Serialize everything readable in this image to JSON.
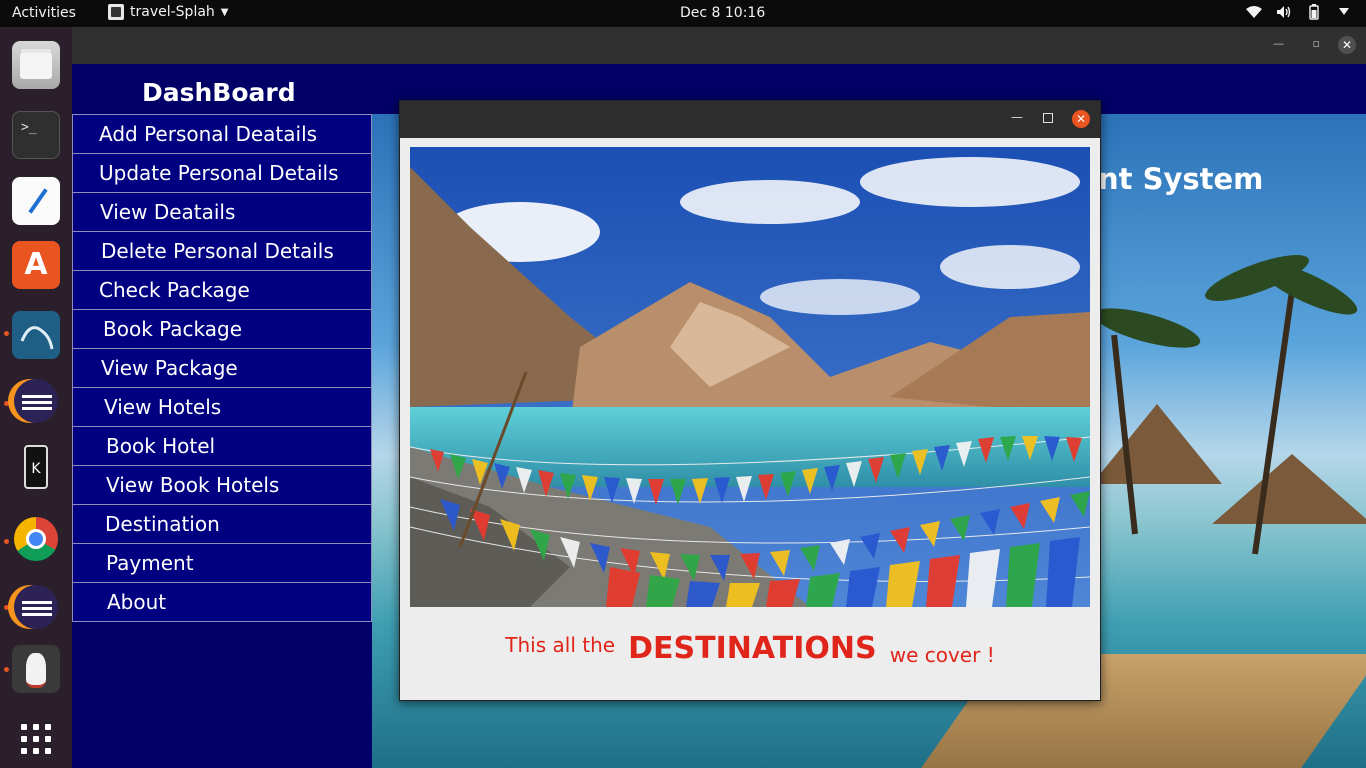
{
  "topbar": {
    "activities": "Activities",
    "app_name": "travel-Splah",
    "clock": "Dec 8  10:16",
    "tray_icons": [
      "wifi-icon",
      "volume-icon",
      "battery-icon",
      "power-menu-icon"
    ]
  },
  "dock": {
    "items": [
      "files",
      "terminal",
      "text-editor",
      "software-store",
      "mysql-workbench",
      "eclipse",
      "kde-connect",
      "chrome",
      "eclipse",
      "java",
      "show-apps"
    ],
    "terminal_glyph": ">_"
  },
  "main_window": {
    "bg_title_fragment": "nt System"
  },
  "sidebar": {
    "title": "DashBoard",
    "items": [
      {
        "label": "Add Personal Deatails"
      },
      {
        "label": "Update Personal Details"
      },
      {
        "label": "View Deatails"
      },
      {
        "label": "Delete Personal Details"
      },
      {
        "label": "Check Package"
      },
      {
        "label": "Book Package"
      },
      {
        "label": "View Package"
      },
      {
        "label": "View Hotels"
      },
      {
        "label": "Book Hotel"
      },
      {
        "label": "View Book Hotels"
      },
      {
        "label": "Destination"
      },
      {
        "label": "Payment"
      },
      {
        "label": "About"
      }
    ]
  },
  "dialog": {
    "caption_pre": "This all the",
    "caption_big": "DESTINATIONS",
    "caption_post": "we cover !"
  },
  "colors": {
    "sidebar_bg": "#000080",
    "caption": "#e0251b",
    "accent": "#e95420"
  }
}
